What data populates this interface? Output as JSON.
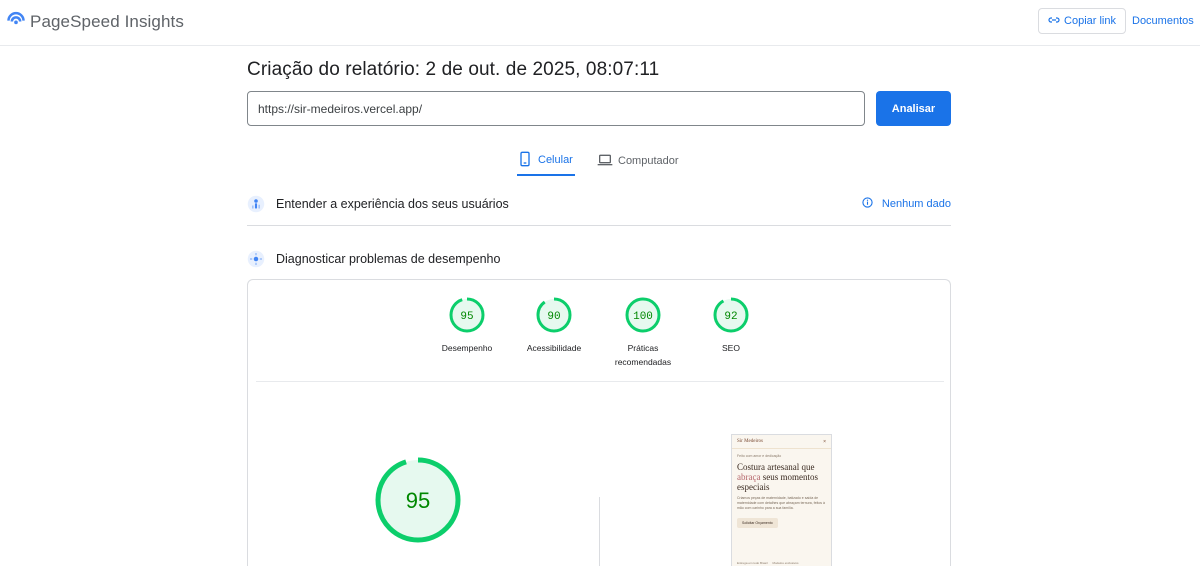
{
  "app": {
    "name": "PageSpeed Insights"
  },
  "header": {
    "copy_link": "Copiar link",
    "docs": "Documentos"
  },
  "report": {
    "title": "Criação do relatório: 2 de out. de 2025, 08:07:11",
    "url": "https://sir-medeiros.vercel.app/",
    "analyze": "Analisar"
  },
  "tabs": {
    "mobile": "Celular",
    "desktop": "Computador"
  },
  "sections": {
    "ux": "Entender a experiência dos seus usuários",
    "no_data": "Nenhum dado",
    "diagnose": "Diagnosticar problemas de desempenho"
  },
  "scores": [
    {
      "value": 95,
      "label": "Desempenho"
    },
    {
      "value": 90,
      "label": "Acessibilidade"
    },
    {
      "value": 100,
      "label": "Práticas recomendadas"
    },
    {
      "value": 92,
      "label": "SEO"
    }
  ],
  "main_score": 95,
  "preview": {
    "logo": "Sir Medeiros",
    "close": "×",
    "badge": "Feito com amor e dedicação",
    "headline_pre": "Costura artesanal que ",
    "headline_accent": "abraça",
    "headline_post": " seus momentos especiais",
    "body": "Criamos peças de maternidade, batizado e saída de maternidade com detalhes que abraçam ternura, feitos à mão com carinho para a sua família.",
    "cta": "Solicitar Orçamento",
    "foot_a": "Entrega em todo Brasil",
    "foot_b": "Modelos exclusivos"
  },
  "colors": {
    "accent": "#1a73e8",
    "pass": "#0cce6b",
    "pass_text": "#008800",
    "pass_fill": "#e6f9ef"
  }
}
